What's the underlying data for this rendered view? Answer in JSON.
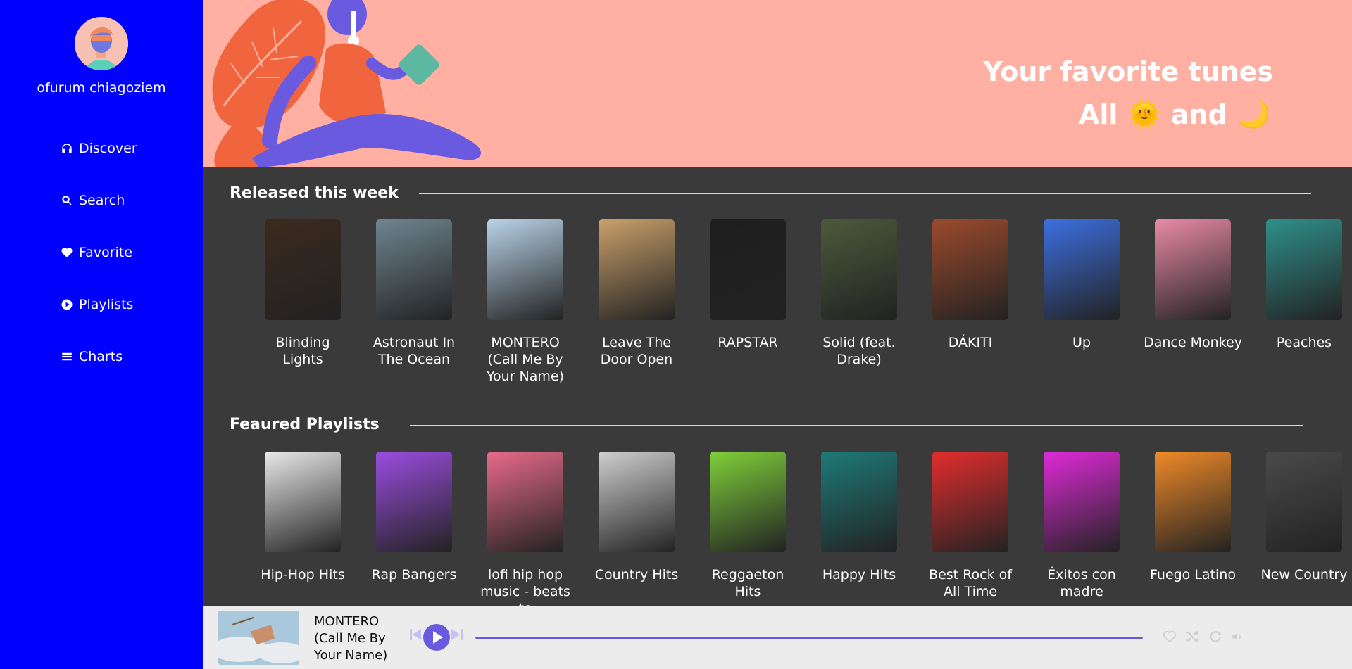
{
  "user": {
    "name": "ofurum chiagoziem"
  },
  "nav": [
    {
      "label": "Discover",
      "icon": "headphones-icon"
    },
    {
      "label": "Search",
      "icon": "search-icon"
    },
    {
      "label": "Favorite",
      "icon": "heart-icon"
    },
    {
      "label": "Playlists",
      "icon": "play-circle-icon"
    },
    {
      "label": "Charts",
      "icon": "bars-icon"
    }
  ],
  "banner": {
    "title": "Your favorite tunes",
    "sub_all": "All",
    "sub_sun": "🌞",
    "sub_and": "and",
    "sub_moon": "🌙"
  },
  "released": {
    "title": "Released this week",
    "items": [
      {
        "label": "Blinding Lights",
        "color": "#3b2a1e"
      },
      {
        "label": "Astronaut In The Ocean",
        "color": "#6f8590"
      },
      {
        "label": "MONTERO (Call Me By Your Name)",
        "color": "#b9d3e8"
      },
      {
        "label": "Leave The Door Open",
        "color": "#c9a06a"
      },
      {
        "label": "RAPSTAR",
        "color": "#1e1e1e"
      },
      {
        "label": "Solid (feat. Drake)",
        "color": "#4b5a3a"
      },
      {
        "label": "DÁKITI",
        "color": "#9b4a2c"
      },
      {
        "label": "Up",
        "color": "#3c6fe0"
      },
      {
        "label": "Dance Monkey",
        "color": "#e88aa8"
      },
      {
        "label": "Peaches",
        "color": "#2f8f8a"
      }
    ]
  },
  "playlists": {
    "title": "Feaured Playlists",
    "items": [
      {
        "label": "Hip-Hop Hits",
        "color": "#e9e9e9"
      },
      {
        "label": "Rap Bangers",
        "color": "#9b4de0"
      },
      {
        "label": "lofi hip hop music - beats to",
        "color": "#e86a8a"
      },
      {
        "label": "Country Hits",
        "color": "#cfcfcf"
      },
      {
        "label": "Reggaeton Hits",
        "color": "#7fd03a"
      },
      {
        "label": "Happy Hits",
        "color": "#1e7a78"
      },
      {
        "label": "Best Rock of All Time",
        "color": "#e32d2d"
      },
      {
        "label": "Éxitos con madre",
        "color": "#e02ad8"
      },
      {
        "label": "Fuego Latino",
        "color": "#f08a28"
      },
      {
        "label": "New Country",
        "color": "#4a4a4a"
      }
    ]
  },
  "player": {
    "title": "MONTERO (Call Me By Your Name)",
    "progress": 0
  }
}
